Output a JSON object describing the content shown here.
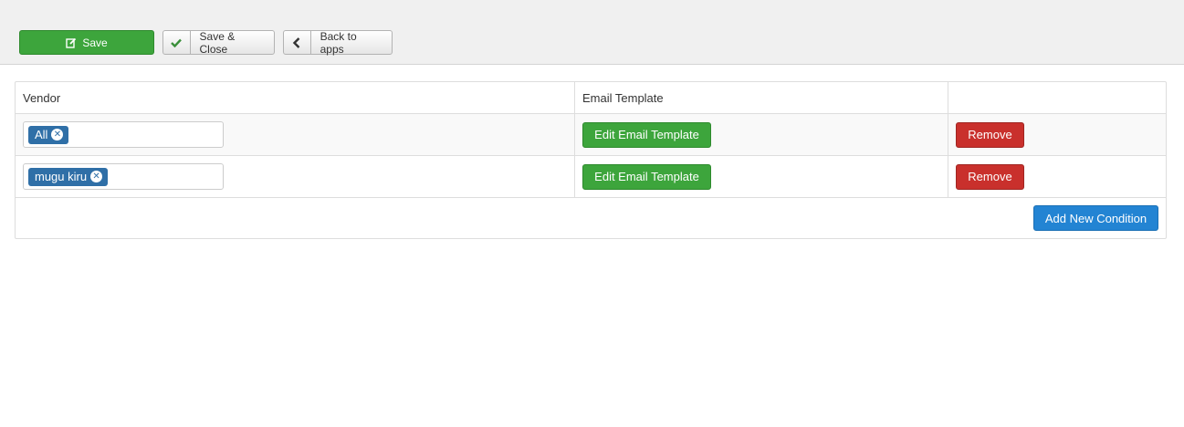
{
  "toolbar": {
    "save_label": "Save",
    "save_close_label": "Save & Close",
    "back_label": "Back to apps"
  },
  "table": {
    "headers": [
      "Vendor",
      "Email Template",
      ""
    ],
    "rows": [
      {
        "vendor_tag": "All",
        "edit_label": "Edit Email Template",
        "remove_label": "Remove"
      },
      {
        "vendor_tag": "mugu kiru",
        "edit_label": "Edit Email Template",
        "remove_label": "Remove"
      }
    ],
    "add_label": "Add New Condition"
  },
  "colors": {
    "success": "#3da53c",
    "danger": "#c9302c",
    "primary": "#2384d3",
    "tag": "#2f6fa7"
  },
  "icons": {
    "save": "edit-icon",
    "save_close": "check-icon",
    "back": "chevron-left-icon",
    "tag_remove": "close-circle-icon"
  }
}
